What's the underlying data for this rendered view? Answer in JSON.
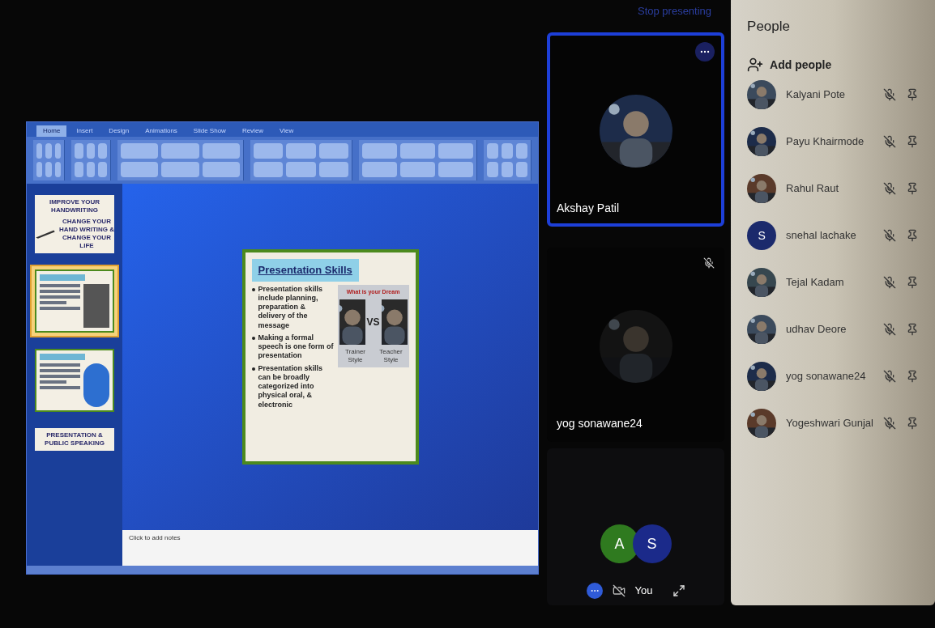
{
  "stop_presenting": "Stop presenting",
  "presentation": {
    "ribbon_tabs": [
      {
        "label": "Home",
        "selected": true
      },
      {
        "label": "Insert",
        "selected": false
      },
      {
        "label": "Design",
        "selected": false
      },
      {
        "label": "Animations",
        "selected": false
      },
      {
        "label": "Slide Show",
        "selected": false
      },
      {
        "label": "Review",
        "selected": false
      },
      {
        "label": "View",
        "selected": false
      }
    ],
    "thumbnails": [
      {
        "kind": "title",
        "title": "IMPROVE YOUR HANDWRITING",
        "subtitle": "CHANGE YOUR HAND WRITING & CHANGE YOUR LIFE",
        "selected": false
      },
      {
        "kind": "content",
        "selected": true
      },
      {
        "kind": "content",
        "selected": false
      },
      {
        "kind": "title",
        "title": "PRESENTATION & PUBLIC SPEAKING",
        "selected": false
      }
    ],
    "slide": {
      "title": "Presentation Skills",
      "bullets": [
        "Presentation skills include planning, preparation & delivery of the message",
        "Making a formal speech is one form of presentation",
        "Presentation skills can be broadly categorized into physical oral, & electronic"
      ],
      "image_heading": "What is your Dream",
      "vs": "VS",
      "captions": [
        "Trainer Style",
        "Teacher Style"
      ]
    },
    "notes_placeholder": "Click to add notes"
  },
  "tiles": [
    {
      "name": "Akshay Patil",
      "active": true,
      "muted": false
    },
    {
      "name": "yog sonawane24",
      "active": false,
      "muted": true
    }
  ],
  "self_tile": {
    "avatars": [
      {
        "letter": "A",
        "color": "#2f7a1f"
      },
      {
        "letter": "S",
        "color": "#1b2a8a"
      }
    ],
    "label": "You"
  },
  "people": {
    "title": "People",
    "add_label": "Add people",
    "list": [
      {
        "name": "Kalyani Pote",
        "kind": "picture"
      },
      {
        "name": "Payu Khairmode",
        "kind": "picture"
      },
      {
        "name": "Rahul Raut",
        "kind": "picture"
      },
      {
        "name": "snehal lachake",
        "kind": "letter",
        "letter": "S",
        "color": "#1b2a6c"
      },
      {
        "name": "Tejal Kadam",
        "kind": "picture"
      },
      {
        "name": "udhav Deore",
        "kind": "picture"
      },
      {
        "name": "yog sonawane24",
        "kind": "picture"
      },
      {
        "name": "Yogeshwari Gunjal",
        "kind": "picture"
      }
    ]
  }
}
